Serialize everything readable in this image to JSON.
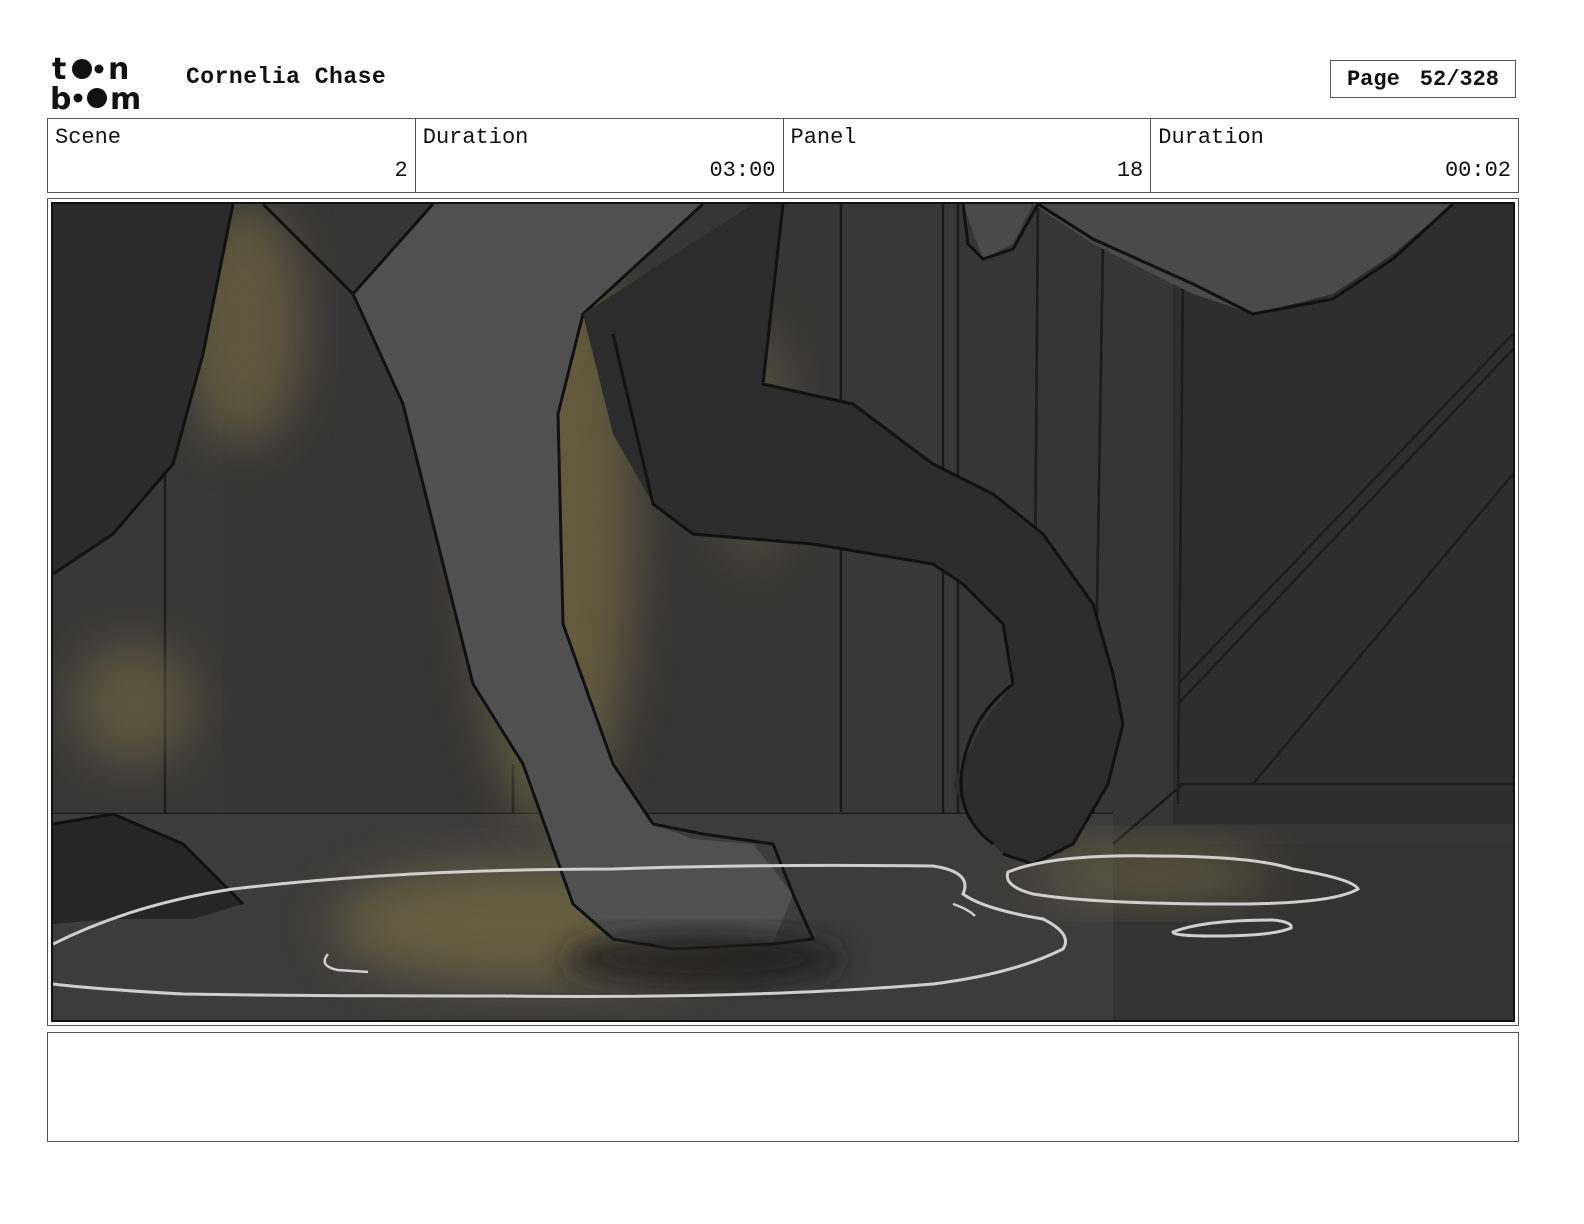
{
  "header": {
    "logo_text": "toon boom",
    "project_title": "Cornelia Chase",
    "page_label": "Page",
    "page_value": "52/328"
  },
  "info": [
    {
      "label": "Scene",
      "value": "2"
    },
    {
      "label": "Duration",
      "value": "03:00"
    },
    {
      "label": "Panel",
      "value": "18"
    },
    {
      "label": "Duration",
      "value": "00:02"
    }
  ],
  "colors": {
    "background_dark": "#3a3a3a",
    "wall_dark": "#2f2f2f",
    "leg_gray": "#525252",
    "glow_yellow": "#8a7a45",
    "puddle_outline": "#d0d0d0"
  },
  "notes": ""
}
